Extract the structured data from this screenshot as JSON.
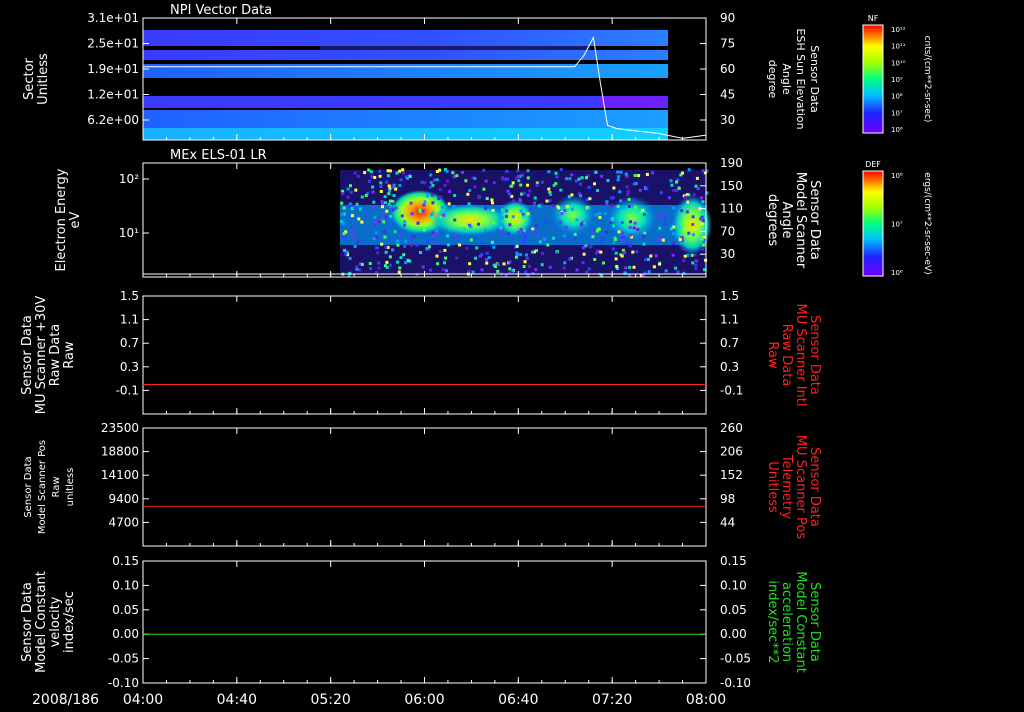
{
  "date_label": "2008/186",
  "time_ticks": [
    "04:00",
    "04:40",
    "05:20",
    "06:00",
    "06:40",
    "07:20",
    "08:00"
  ],
  "colors": {
    "axis": "#ffffff",
    "red": "#ff2020",
    "green": "#20e020",
    "background": "#000000"
  },
  "chart_data": [
    {
      "type": "heatmap",
      "title": "NPI Vector Data",
      "ylabel_left": [
        "Sector",
        "Unitless"
      ],
      "yticks_left": [
        "3.1e+01",
        "2.5e+01",
        "1.9e+01",
        "1.2e+01",
        "6.2e+00"
      ],
      "ylabel_right": [
        "Sensor Data",
        "ESH Sun Elevation",
        "Angle",
        "degree"
      ],
      "yticks_right": [
        "90",
        "75",
        "60",
        "45",
        "30"
      ],
      "yrange_right": [
        15,
        90
      ],
      "colorbar": {
        "label": "NF",
        "units": "cnts/(cm**2-sr-sec)",
        "ticks": [
          "10¹²",
          "10¹¹",
          "10¹⁰",
          "10⁹",
          "10⁸",
          "10⁷",
          "10⁶"
        ]
      },
      "line_series": {
        "color": "#ffffff",
        "x": [
          "04:00",
          "07:04",
          "07:08",
          "07:12",
          "07:15",
          "07:18",
          "07:22",
          "07:40",
          "07:50",
          "07:55",
          "08:00"
        ],
        "y": [
          60,
          60,
          67,
          78,
          50,
          24,
          22,
          19,
          16,
          17,
          18
        ]
      }
    },
    {
      "type": "heatmap",
      "title": "MEx ELS-01 LR",
      "ylabel_left": [
        "Electron Energy",
        "eV"
      ],
      "yticks_left": [
        "10²",
        "10¹"
      ],
      "ylabel_right": [
        "Sensor Data",
        "Model Scanner",
        "Angle",
        "degrees"
      ],
      "yticks_right": [
        "190",
        "150",
        "110",
        "70",
        "30"
      ],
      "yrange_right": [
        0,
        190
      ],
      "colorbar": {
        "label": "DEF",
        "units": "ergs/(cm**2-sr-sec-eV)",
        "ticks": [
          "10⁸",
          "10⁷",
          "10⁶"
        ]
      },
      "line_series": {
        "color": "#ffffff",
        "x": [
          "04:00",
          "08:00"
        ],
        "y": [
          5,
          5
        ]
      }
    },
    {
      "type": "line",
      "ylabel_left": [
        "Sensor Data",
        "MU Scanner +30V",
        "Raw Data",
        "Raw"
      ],
      "yticks_left": [
        "1.5",
        "1.1",
        "0.7",
        "0.3",
        "-0.1"
      ],
      "ylabel_right": [
        "Sensor Data",
        "MU Scanner Intl",
        "Raw Data",
        "Raw"
      ],
      "yticks_right": [
        "1.5",
        "1.1",
        "0.7",
        "0.3",
        "-0.1"
      ],
      "ylim": [
        -0.5,
        1.5
      ],
      "series": [
        {
          "color": "#ff2020",
          "x": [
            "04:00",
            "08:00"
          ],
          "values": [
            0.0,
            0.0
          ]
        }
      ]
    },
    {
      "type": "line",
      "ylabel_left": [
        "Sensor Data",
        "Model Scanner Pos",
        "Raw",
        "unitless"
      ],
      "yticks_left": [
        "23500",
        "18800",
        "14100",
        "9400",
        "4700"
      ],
      "ylabel_right": [
        "Sensor Data",
        "MU Scanner Pos",
        "Telemetry",
        "Unitless"
      ],
      "yticks_right": [
        "260",
        "206",
        "152",
        "98",
        "44"
      ],
      "ylim": [
        0,
        23500
      ],
      "series": [
        {
          "color": "#ff2020",
          "x": [
            "04:00",
            "08:00"
          ],
          "values": [
            7900,
            7900
          ]
        }
      ]
    },
    {
      "type": "line",
      "ylabel_left": [
        "Sensor Data",
        "Model Constant",
        "velocity",
        "index/sec"
      ],
      "yticks_left": [
        "0.15",
        "0.10",
        "0.05",
        "0.00",
        "-0.05",
        "-0.10"
      ],
      "ylabel_right": [
        "Sensor Data",
        "Model Constant",
        "acceleration",
        "index/sec**2"
      ],
      "yticks_right": [
        "0.15",
        "0.10",
        "0.05",
        "0.00",
        "-0.05",
        "-0.10"
      ],
      "ylim": [
        -0.1,
        0.15
      ],
      "series": [
        {
          "color": "#20e020",
          "x": [
            "04:00",
            "08:00"
          ],
          "values": [
            0.0,
            0.0
          ]
        }
      ]
    }
  ]
}
